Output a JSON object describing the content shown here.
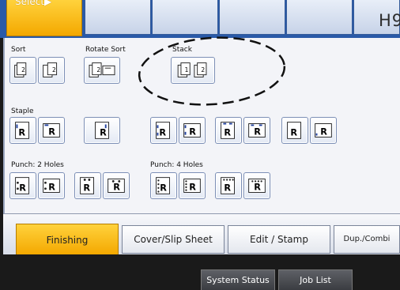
{
  "top": {
    "select_label": "Select▶",
    "right_label": "H9"
  },
  "panel": {
    "groups": {
      "sort": "Sort",
      "rotate_sort": "Rotate Sort",
      "stack": "Stack",
      "staple": "Staple",
      "punch_2": "Punch: 2 Holes",
      "punch_4": "Punch: 4 Holes"
    },
    "option_glyph_letter": "R"
  },
  "tabs": [
    {
      "label": "Finishing"
    },
    {
      "label": "Cover/Slip Sheet"
    },
    {
      "label": "Edit / Stamp"
    },
    {
      "label": "Dup./Combi"
    }
  ],
  "bottom": {
    "system_status": "System Status",
    "job_list": "Job List"
  },
  "colors": {
    "accent": "#f4a800",
    "panel_bg": "#f3f4f8",
    "top_bar": "#2a5aa8",
    "staple_mark": "#1f3f9e"
  },
  "icons": {
    "sort": "sort-stack-icon",
    "rotate": "rotate-sort-icon",
    "stack": "stack-icon",
    "staple": "staple-position-icon",
    "punch": "punch-holes-icon"
  }
}
